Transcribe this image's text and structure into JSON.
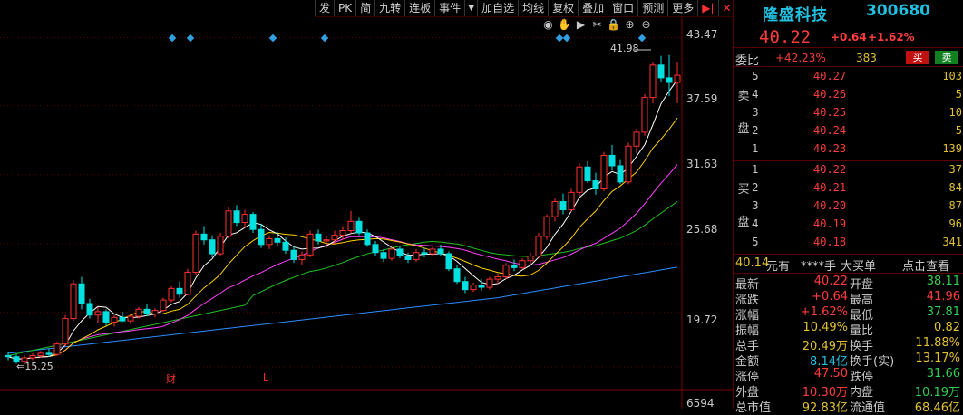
{
  "toolbar": {
    "items": [
      "发",
      "PK",
      "简",
      "九转",
      "连板",
      "事件",
      "▼",
      "加自选",
      "均线",
      "复权",
      "叠加",
      "窗口",
      "预测",
      "更多",
      "▶|",
      "✕"
    ],
    "icons": [
      "eye-icon",
      "hand-icon",
      "play-icon",
      "scissors-icon",
      "lock-icon",
      "zoom-in-icon",
      "zoom-out-icon"
    ]
  },
  "stock": {
    "name": "隆盛科技",
    "code": "300680",
    "price": "40.22",
    "change": "+0.64",
    "change_pct": "+1.62%"
  },
  "chart": {
    "price_axis": [
      "43.47",
      "37.59",
      "31.63",
      "25.68",
      "19.72"
    ],
    "volume_axis": "6594",
    "high_label": "41.98",
    "low_label": "15.25",
    "markers": [
      "财",
      "L"
    ],
    "colors": {
      "up": "#ff3030",
      "down": "#00e0e0",
      "ma5": "#ffffff",
      "ma10": "#ffd000",
      "ma20": "#ff40ff",
      "ma30": "#20c020",
      "ma60": "#2a8cff"
    }
  },
  "chart_data": {
    "type": "candlestick",
    "ylim": [
      15.0,
      43.47
    ],
    "ohlc": [
      [
        16.0,
        16.3,
        15.6,
        15.9
      ],
      [
        15.9,
        16.1,
        15.3,
        15.5
      ],
      [
        15.5,
        16.0,
        15.25,
        15.8
      ],
      [
        15.8,
        16.2,
        15.6,
        16.0
      ],
      [
        16.0,
        16.4,
        15.8,
        16.2
      ],
      [
        16.2,
        16.6,
        15.9,
        16.1
      ],
      [
        16.1,
        17.2,
        16.0,
        17.0
      ],
      [
        17.0,
        19.5,
        16.8,
        19.2
      ],
      [
        19.2,
        22.5,
        19.0,
        22.2
      ],
      [
        22.2,
        22.8,
        20.0,
        20.5
      ],
      [
        20.5,
        20.9,
        19.2,
        19.5
      ],
      [
        19.5,
        20.2,
        18.8,
        19.8
      ],
      [
        19.8,
        20.0,
        18.6,
        18.9
      ],
      [
        18.9,
        19.5,
        18.5,
        19.3
      ],
      [
        19.3,
        19.8,
        18.9,
        19.0
      ],
      [
        19.0,
        19.6,
        18.7,
        19.4
      ],
      [
        19.4,
        20.2,
        19.2,
        20.0
      ],
      [
        20.0,
        20.5,
        19.4,
        19.6
      ],
      [
        19.6,
        20.1,
        19.3,
        19.9
      ],
      [
        19.9,
        21.0,
        19.8,
        20.8
      ],
      [
        20.8,
        22.0,
        20.6,
        21.8
      ],
      [
        21.8,
        22.4,
        21.0,
        21.3
      ],
      [
        21.3,
        23.5,
        21.2,
        23.2
      ],
      [
        23.2,
        26.8,
        23.0,
        26.5
      ],
      [
        26.5,
        27.2,
        25.6,
        26.0
      ],
      [
        26.0,
        26.4,
        24.5,
        24.8
      ],
      [
        24.8,
        26.6,
        24.6,
        26.3
      ],
      [
        26.3,
        28.8,
        26.1,
        28.5
      ],
      [
        28.5,
        29.0,
        27.2,
        27.5
      ],
      [
        27.5,
        28.6,
        27.0,
        28.2
      ],
      [
        28.2,
        28.4,
        26.6,
        26.9
      ],
      [
        26.9,
        27.4,
        25.3,
        25.6
      ],
      [
        25.6,
        26.4,
        25.2,
        26.1
      ],
      [
        26.1,
        26.7,
        25.5,
        25.8
      ],
      [
        25.8,
        26.2,
        24.8,
        25.1
      ],
      [
        25.1,
        25.5,
        24.0,
        24.3
      ],
      [
        24.3,
        25.0,
        23.8,
        24.7
      ],
      [
        24.7,
        26.8,
        24.5,
        26.5
      ],
      [
        26.5,
        26.9,
        25.6,
        25.9
      ],
      [
        25.9,
        26.3,
        25.3,
        26.0
      ],
      [
        26.0,
        26.8,
        25.7,
        26.4
      ],
      [
        26.4,
        27.2,
        26.0,
        26.8
      ],
      [
        26.8,
        28.5,
        26.6,
        27.6
      ],
      [
        27.6,
        27.9,
        26.4,
        26.6
      ],
      [
        26.6,
        26.9,
        25.4,
        25.6
      ],
      [
        25.6,
        25.9,
        24.6,
        24.9
      ],
      [
        24.9,
        25.2,
        24.1,
        24.4
      ],
      [
        24.4,
        25.4,
        24.2,
        25.2
      ],
      [
        25.2,
        25.5,
        24.4,
        24.6
      ],
      [
        24.6,
        24.9,
        24.0,
        24.3
      ],
      [
        24.3,
        25.2,
        24.1,
        24.9
      ],
      [
        24.9,
        25.3,
        24.5,
        24.8
      ],
      [
        24.8,
        25.4,
        24.6,
        25.2
      ],
      [
        25.2,
        25.6,
        24.6,
        24.8
      ],
      [
        24.8,
        25.0,
        23.3,
        23.5
      ],
      [
        23.5,
        23.8,
        22.2,
        22.4
      ],
      [
        22.4,
        22.8,
        21.4,
        21.7
      ],
      [
        21.7,
        22.3,
        21.5,
        22.1
      ],
      [
        22.1,
        22.6,
        21.6,
        21.9
      ],
      [
        21.9,
        22.8,
        21.7,
        22.6
      ],
      [
        22.6,
        23.1,
        22.2,
        22.8
      ],
      [
        22.8,
        24.0,
        22.6,
        23.8
      ],
      [
        23.8,
        24.3,
        23.3,
        23.6
      ],
      [
        23.6,
        24.4,
        23.4,
        24.2
      ],
      [
        24.2,
        24.9,
        23.8,
        24.6
      ],
      [
        24.6,
        26.6,
        24.4,
        26.3
      ],
      [
        26.3,
        28.2,
        26.0,
        28.0
      ],
      [
        28.0,
        29.6,
        27.6,
        29.3
      ],
      [
        29.3,
        30.0,
        28.2,
        28.6
      ],
      [
        28.6,
        30.4,
        28.4,
        30.1
      ],
      [
        30.1,
        32.6,
        29.8,
        32.3
      ],
      [
        32.3,
        32.8,
        30.9,
        31.1
      ],
      [
        31.1,
        31.8,
        29.9,
        30.4
      ],
      [
        30.4,
        33.6,
        30.2,
        33.3
      ],
      [
        33.3,
        34.2,
        32.0,
        32.4
      ],
      [
        32.4,
        32.9,
        30.8,
        31.0
      ],
      [
        31.0,
        34.4,
        30.8,
        34.1
      ],
      [
        34.1,
        35.6,
        33.5,
        35.3
      ],
      [
        35.3,
        38.6,
        35.0,
        38.3
      ],
      [
        38.3,
        41.4,
        37.8,
        41.1
      ],
      [
        41.1,
        41.9,
        39.6,
        40.0
      ],
      [
        40.0,
        41.98,
        38.4,
        39.6
      ],
      [
        39.6,
        41.4,
        37.81,
        40.22
      ]
    ],
    "volume_axis_max": "6594"
  },
  "quote": {
    "wb_label": "委比",
    "wb_pct": "+42.23%",
    "wb_diff": "383",
    "buy_btn": "买",
    "sell_btn": "卖",
    "sell_side_label": [
      "卖",
      "盘"
    ],
    "buy_side_label": [
      "买",
      "盘"
    ],
    "asks": [
      {
        "lvl": "5",
        "price": "40.27",
        "vol": "103"
      },
      {
        "lvl": "4",
        "price": "40.26",
        "vol": "5"
      },
      {
        "lvl": "3",
        "price": "40.25",
        "vol": "10"
      },
      {
        "lvl": "2",
        "price": "40.24",
        "vol": "5"
      },
      {
        "lvl": "1",
        "price": "40.23",
        "vol": "139"
      }
    ],
    "bids": [
      {
        "lvl": "1",
        "price": "40.22",
        "vol": "37"
      },
      {
        "lvl": "2",
        "price": "40.21",
        "vol": "84"
      },
      {
        "lvl": "3",
        "price": "40.20",
        "vol": "87"
      },
      {
        "lvl": "4",
        "price": "40.19",
        "vol": "96"
      },
      {
        "lvl": "5",
        "price": "40.18",
        "vol": "341"
      }
    ],
    "summary": {
      "value": "40.14",
      "unit": "元有",
      "stars": "****手",
      "big": "大买单",
      "link": "点击查看"
    },
    "stats": [
      {
        "l": "最新",
        "lv": "40.22",
        "lc": "red",
        "r": "开盘",
        "rv": "38.11",
        "rc": "grn"
      },
      {
        "l": "涨跌",
        "lv": "+0.64",
        "lc": "red",
        "r": "最高",
        "rv": "41.96",
        "rc": "red"
      },
      {
        "l": "涨幅",
        "lv": "+1.62%",
        "lc": "red",
        "r": "最低",
        "rv": "37.81",
        "rc": "grn"
      },
      {
        "l": "振幅",
        "lv": "10.49%",
        "lc": "yel",
        "r": "量比",
        "rv": "0.82",
        "rc": "yel"
      },
      {
        "l": "总手",
        "lv": "20.49万",
        "lc": "yel",
        "r": "换手",
        "rv": "11.88%",
        "rc": "yel"
      },
      {
        "l": "金额",
        "lv": "8.14亿",
        "lc": "cyn",
        "r": "换手(实)",
        "rv": "13.17%",
        "rc": "yel"
      },
      {
        "l": "涨停",
        "lv": "47.50",
        "lc": "red",
        "r": "跌停",
        "rv": "31.66",
        "rc": "grn"
      },
      {
        "l": "外盘",
        "lv": "10.30万",
        "lc": "red",
        "r": "内盘",
        "rv": "10.19万",
        "rc": "grn"
      },
      {
        "l": "总市值",
        "lv": "92.83亿",
        "lc": "yel",
        "r": "流通值",
        "rv": "68.46亿",
        "rc": "yel"
      }
    ]
  }
}
